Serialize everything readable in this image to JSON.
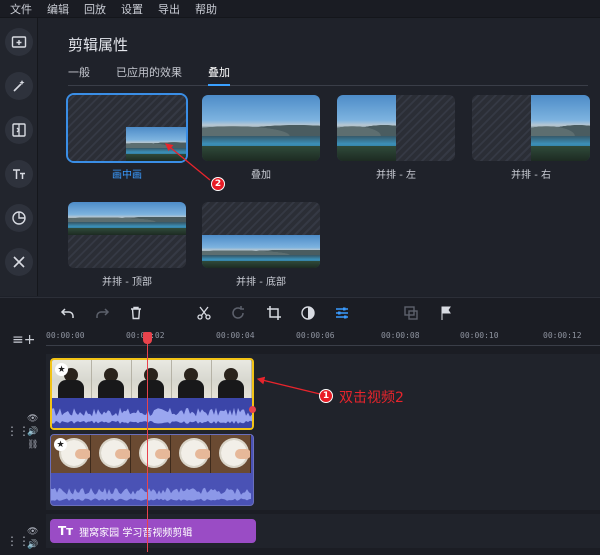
{
  "menu": [
    "文件",
    "编辑",
    "回放",
    "设置",
    "导出",
    "帮助"
  ],
  "panel": {
    "title": "剪辑属性",
    "tabs": [
      {
        "label": "一般",
        "active": false
      },
      {
        "label": "已应用的效果",
        "active": false
      },
      {
        "label": "叠加",
        "active": true
      }
    ],
    "presets": [
      {
        "label": "画中画",
        "selected": true
      },
      {
        "label": "叠加",
        "selected": false
      },
      {
        "label": "并排 - 左",
        "selected": false
      },
      {
        "label": "并排 - 右",
        "selected": false
      },
      {
        "label": "并排 - 顶部",
        "selected": false
      },
      {
        "label": "并排 - 底部",
        "selected": false
      }
    ]
  },
  "timeline": {
    "ticks": [
      "00:00:00",
      "00:00:02",
      "00:00:04",
      "00:00:06",
      "00:00:08",
      "00:00:10",
      "00:00:12"
    ],
    "text_clip": "狸窝家园 学习音视频剪辑"
  },
  "annotations": {
    "badge1": "1",
    "badge2": "2",
    "callout1": "双击视频2"
  },
  "colors": {
    "accent": "#3a9bff",
    "selected_clip": "#f2c316",
    "playhead": "#e8434c",
    "annotation": "#e8242c",
    "text_clip": "#9a4cc5"
  }
}
